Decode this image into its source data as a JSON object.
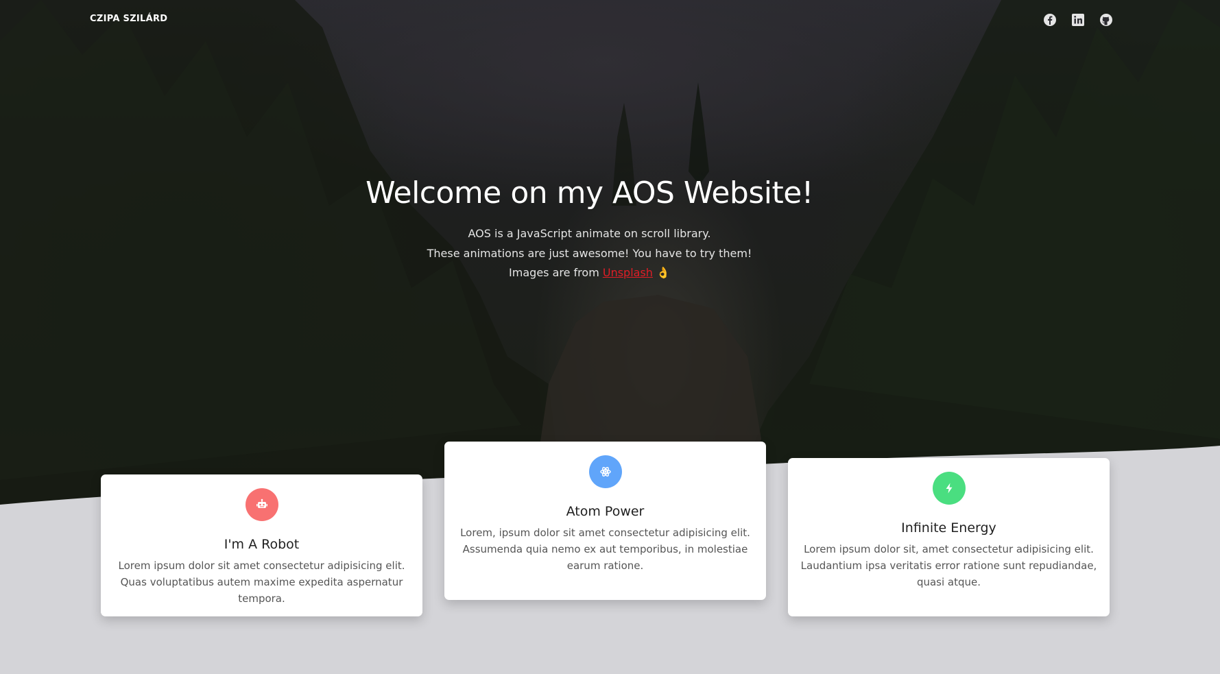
{
  "nav": {
    "brand": "CZIPA SZILÁRD",
    "socials": [
      {
        "icon": "facebook-icon"
      },
      {
        "icon": "linkedin-icon"
      },
      {
        "icon": "github-icon"
      }
    ]
  },
  "hero": {
    "title": "Welcome on my AOS Website!",
    "line1": "AOS is a JavaScript animate on scroll library.",
    "line2": "These animations are just awesome! You have to try them!",
    "line3_prefix": "Images are from ",
    "line3_link": "Unsplash",
    "line3_emoji": "👌"
  },
  "cards": [
    {
      "icon": "robot-icon",
      "color": "#f87171",
      "title": "I'm A Robot",
      "text": "Lorem ipsum dolor sit amet consectetur adipisicing elit. Quas voluptatibus autem maxime expedita aspernatur tempora."
    },
    {
      "icon": "atom-icon",
      "color": "#60a5fa",
      "title": "Atom Power",
      "text": "Lorem, ipsum dolor sit amet consectetur adipisicing elit. Assumenda quia nemo ex aut temporibus, in molestiae earum ratione."
    },
    {
      "icon": "lightning-bolt-icon",
      "color": "#4ade80",
      "title": "Infinite Energy",
      "text": "Lorem ipsum dolor sit, amet consectetur adipisicing elit. Laudantium ipsa veritatis error ratione sunt repudiandae, quasi atque."
    }
  ],
  "colors": {
    "link": "#e11d26",
    "lower_bg": "#d4d4d8"
  }
}
